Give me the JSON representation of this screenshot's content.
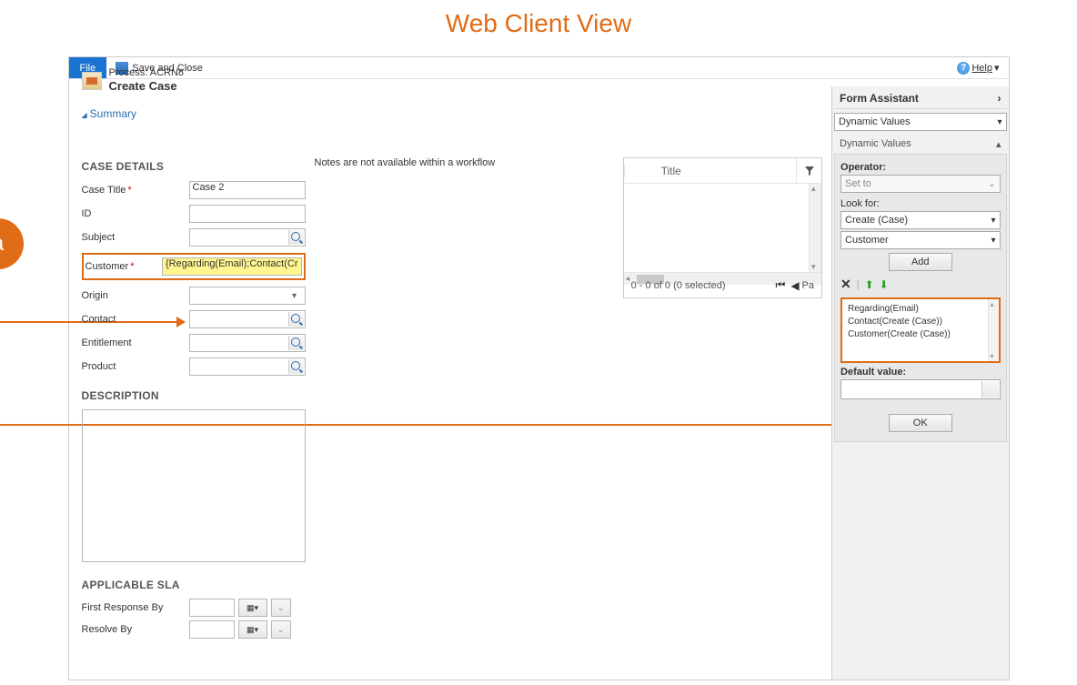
{
  "page_title": "Web Client View",
  "annotation": {
    "badge": "a"
  },
  "toolbar": {
    "file": "File",
    "save_and_close": "Save and Close",
    "help": "Help"
  },
  "process": {
    "label": "Process: ACRN8",
    "name": "Create Case"
  },
  "summary_link": "Summary",
  "case_details": {
    "section_title": "CASE DETAILS",
    "case_title_label": "Case Title",
    "case_title_value": "Case 2",
    "id_label": "ID",
    "id_value": "",
    "subject_label": "Subject",
    "subject_value": "",
    "customer_label": "Customer",
    "customer_value": "{Regarding(Email);Contact(Cr",
    "origin_label": "Origin",
    "contact_label": "Contact",
    "entitlement_label": "Entitlement",
    "product_label": "Product"
  },
  "description": {
    "section_title": "DESCRIPTION"
  },
  "sla": {
    "section_title": "APPLICABLE SLA",
    "first_response_label": "First Response By",
    "resolve_by_label": "Resolve By"
  },
  "notes": {
    "text": "Notes are not available within a workflow"
  },
  "subgrid": {
    "title_header": "Title",
    "pager": "0 - 0 of 0 (0 selected)",
    "page_label": "Pa"
  },
  "form_assistant": {
    "title": "Form Assistant",
    "dynamic_values_select": "Dynamic Values",
    "dynamic_values_sub": "Dynamic Values",
    "operator_label": "Operator:",
    "operator_value": "Set to",
    "look_for_label": "Look for:",
    "look_for_entity": "Create (Case)",
    "look_for_attr": "Customer",
    "add_btn": "Add",
    "list": [
      "Regarding(Email)",
      "Contact(Create (Case))",
      "Customer(Create (Case))"
    ],
    "default_value_label": "Default value:",
    "ok_btn": "OK"
  }
}
